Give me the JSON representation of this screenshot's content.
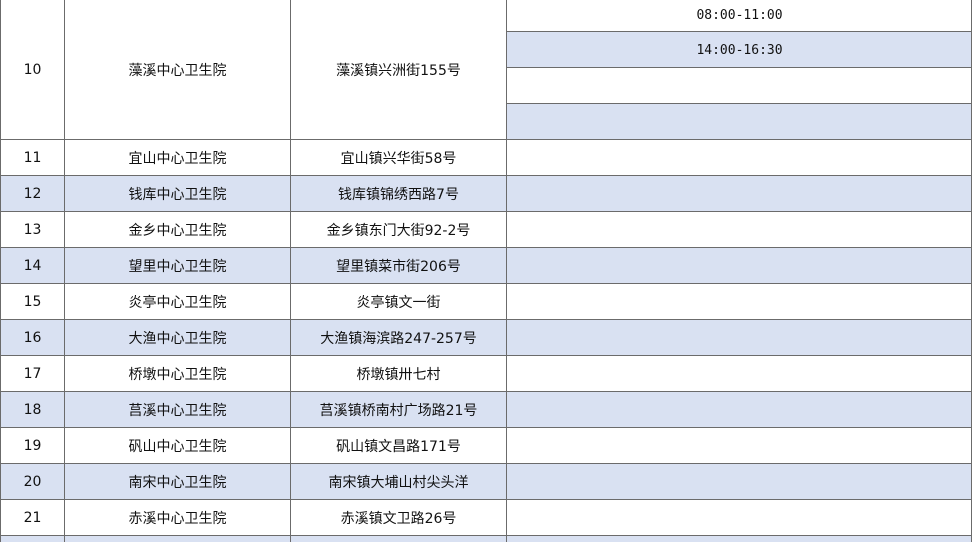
{
  "row10": {
    "no": "10",
    "name": "藻溪中心卫生院",
    "address": "藻溪镇兴洲街155号",
    "times": [
      "08:00-11:00",
      "14:00-16:30",
      "",
      ""
    ]
  },
  "rows": [
    {
      "no": "11",
      "name": "宜山中心卫生院",
      "address": "宜山镇兴华街58号",
      "time": ""
    },
    {
      "no": "12",
      "name": "钱库中心卫生院",
      "address": "钱库镇锦绣西路7号",
      "time": ""
    },
    {
      "no": "13",
      "name": "金乡中心卫生院",
      "address": "金乡镇东门大街92-2号",
      "time": ""
    },
    {
      "no": "14",
      "name": "望里中心卫生院",
      "address": "望里镇菜市街206号",
      "time": ""
    },
    {
      "no": "15",
      "name": "炎亭中心卫生院",
      "address": "炎亭镇文一街",
      "time": ""
    },
    {
      "no": "16",
      "name": "大渔中心卫生院",
      "address": "大渔镇海滨路247-257号",
      "time": ""
    },
    {
      "no": "17",
      "name": "桥墩中心卫生院",
      "address": "桥墩镇卅七村",
      "time": ""
    },
    {
      "no": "18",
      "name": "莒溪中心卫生院",
      "address": "莒溪镇桥南村广场路21号",
      "time": ""
    },
    {
      "no": "19",
      "name": "矾山中心卫生院",
      "address": "矾山镇文昌路171号",
      "time": ""
    },
    {
      "no": "20",
      "name": "南宋中心卫生院",
      "address": "南宋镇大埔山村尖头洋",
      "time": ""
    },
    {
      "no": "21",
      "name": "赤溪中心卫生院",
      "address": "赤溪镇文卫路26号",
      "time": ""
    }
  ],
  "colors": {
    "shade": "#d9e1f2",
    "border": "#6b6b6b"
  }
}
